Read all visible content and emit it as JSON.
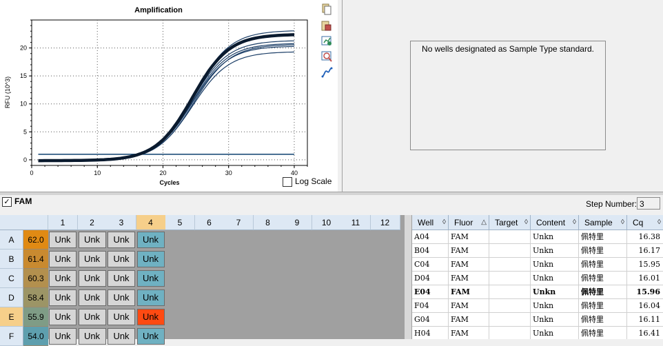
{
  "chart": {
    "title": "Amplification",
    "xlabel": "Cycles",
    "ylabel": "RFU (10^3)",
    "log_scale_label": "Log Scale"
  },
  "chart_data": {
    "type": "line",
    "title": "Amplification",
    "xlabel": "Cycles",
    "ylabel": "RFU (10^3)",
    "xlim": [
      0,
      42
    ],
    "ylim": [
      -1,
      25
    ],
    "xticks": [
      0,
      10,
      20,
      30,
      40
    ],
    "yticks": [
      0,
      5,
      10,
      15,
      20
    ],
    "grid": true,
    "threshold": 1.0,
    "curve_color": "#1a3d66",
    "highlight_color": "#0a1a2e",
    "series": [
      {
        "well": "A04",
        "plateau": 19.5,
        "cq": 16.38
      },
      {
        "well": "B04",
        "plateau": 20.5,
        "cq": 16.17
      },
      {
        "well": "C04",
        "plateau": 22.5,
        "cq": 15.95
      },
      {
        "well": "D04",
        "plateau": 21.5,
        "cq": 16.01
      },
      {
        "well": "E04",
        "plateau": 22.6,
        "cq": 15.96,
        "highlight": true
      },
      {
        "well": "F04",
        "plateau": 23.3,
        "cq": 16.04
      },
      {
        "well": "G04",
        "plateau": 21.0,
        "cq": 16.11
      },
      {
        "well": "H04",
        "plateau": 20.8,
        "cq": 16.41
      }
    ]
  },
  "standard_curve": {
    "message": "No wells designated as Sample Type standard."
  },
  "fluor": {
    "checked_mark": "✓",
    "name": "FAM"
  },
  "step": {
    "label": "Step Number:",
    "value": "3"
  },
  "plate": {
    "columns": [
      "1",
      "2",
      "3",
      "4",
      "5",
      "6",
      "7",
      "8",
      "9",
      "10",
      "11",
      "12"
    ],
    "selected_column": "4",
    "rows": [
      {
        "label": "A",
        "temp": "62.0",
        "temp_color": "#e08a14",
        "wells": [
          "Unk",
          "Unk",
          "Unk",
          "Unk"
        ],
        "hot": false
      },
      {
        "label": "B",
        "temp": "61.4",
        "temp_color": "#c98a30",
        "wells": [
          "Unk",
          "Unk",
          "Unk",
          "Unk"
        ],
        "hot": false
      },
      {
        "label": "C",
        "temp": "60.3",
        "temp_color": "#b3904e",
        "wells": [
          "Unk",
          "Unk",
          "Unk",
          "Unk"
        ],
        "hot": false
      },
      {
        "label": "D",
        "temp": "58.4",
        "temp_color": "#9c9566",
        "wells": [
          "Unk",
          "Unk",
          "Unk",
          "Unk"
        ],
        "hot": false
      },
      {
        "label": "E",
        "temp": "55.9",
        "temp_color": "#7f9c86",
        "wells": [
          "Unk",
          "Unk",
          "Unk",
          "Unk"
        ],
        "hot": true,
        "selected": true
      },
      {
        "label": "F",
        "temp": "54.0",
        "temp_color": "#5e9fae",
        "wells": [
          "Unk",
          "Unk",
          "Unk",
          "Unk"
        ],
        "hot": false
      }
    ]
  },
  "table": {
    "headers": [
      "Well",
      "Fluor",
      "Target",
      "Content",
      "Sample",
      "Cq"
    ],
    "sort_glyphs": [
      "◊",
      "△",
      "◊",
      "◊",
      "◊",
      "◊"
    ],
    "rows": [
      {
        "well": "A04",
        "fluor": "FAM",
        "target": "",
        "content": "Unkn",
        "sample": "佩特里",
        "cq": "16.38"
      },
      {
        "well": "B04",
        "fluor": "FAM",
        "target": "",
        "content": "Unkn",
        "sample": "佩特里",
        "cq": "16.17"
      },
      {
        "well": "C04",
        "fluor": "FAM",
        "target": "",
        "content": "Unkn",
        "sample": "佩特里",
        "cq": "15.95"
      },
      {
        "well": "D04",
        "fluor": "FAM",
        "target": "",
        "content": "Unkn",
        "sample": "佩特里",
        "cq": "16.01"
      },
      {
        "well": "E04",
        "fluor": "FAM",
        "target": "",
        "content": "Unkn",
        "sample": "佩特里",
        "cq": "15.96",
        "bold": true
      },
      {
        "well": "F04",
        "fluor": "FAM",
        "target": "",
        "content": "Unkn",
        "sample": "佩特里",
        "cq": "16.04"
      },
      {
        "well": "G04",
        "fluor": "FAM",
        "target": "",
        "content": "Unkn",
        "sample": "佩特里",
        "cq": "16.11"
      },
      {
        "well": "H04",
        "fluor": "FAM",
        "target": "",
        "content": "Unkn",
        "sample": "佩特里",
        "cq": "16.41"
      }
    ]
  },
  "toolbar_icons": [
    "copy-icon",
    "export-icon",
    "refresh-graph-icon",
    "zoom-graph-icon",
    "curve-settings-icon"
  ]
}
